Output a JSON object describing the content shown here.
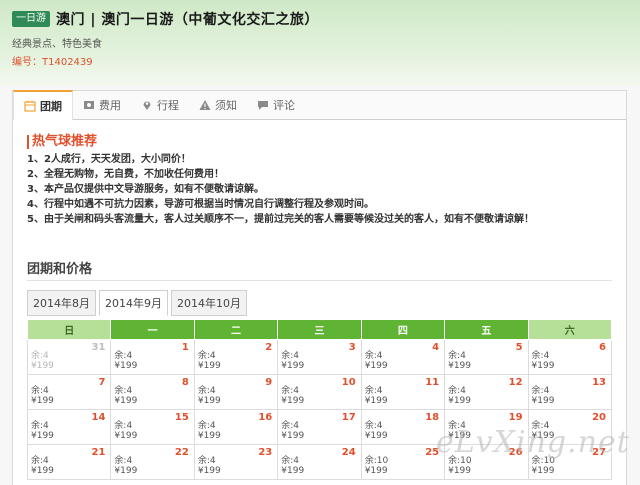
{
  "header": {
    "badge": "一日游",
    "title": "澳门 | 澳门一日游（中葡文化交汇之旅）",
    "subtitle": "经典景点、特色美食",
    "code": "编号：T1402439"
  },
  "tabs": [
    {
      "label": "团期",
      "icon": "calendar-icon",
      "active": true
    },
    {
      "label": "费用",
      "icon": "money-icon"
    },
    {
      "label": "行程",
      "icon": "map-pin-icon"
    },
    {
      "label": "须知",
      "icon": "warning-icon"
    },
    {
      "label": "评论",
      "icon": "comment-icon"
    }
  ],
  "promo": {
    "title": "热气球推荐",
    "items": [
      "1、2人成行，天天发团，大小同价！",
      "2、全程无购物，无自费，不加收任何费用！",
      "3、本产品仅提供中文导游服务，如有不便敬请谅解。",
      "4、行程中如遇不可抗力因素，导游可根据当时情况自行调整行程及参观时间。",
      "5、由于关闸和码头客流量大，客人过关顺序不一，提前过完关的客人需要等候没过关的客人，如有不便敬请谅解！"
    ]
  },
  "section_title": "团期和价格",
  "month_tabs": [
    "2014年8月",
    "2014年9月",
    "2014年10月"
  ],
  "active_month": 1,
  "weekdays": [
    "日",
    "一",
    "二",
    "三",
    "四",
    "五",
    "六"
  ],
  "calendar": [
    [
      {
        "d": "31",
        "s1": "余:4",
        "s2": "¥199",
        "past": true
      },
      {
        "d": "1",
        "s1": "余:4",
        "s2": "¥199"
      },
      {
        "d": "2",
        "s1": "余:4",
        "s2": "¥199"
      },
      {
        "d": "3",
        "s1": "余:4",
        "s2": "¥199"
      },
      {
        "d": "4",
        "s1": "余:4",
        "s2": "¥199"
      },
      {
        "d": "5",
        "s1": "余:4",
        "s2": "¥199"
      },
      {
        "d": "6",
        "s1": "余:4",
        "s2": "¥199"
      }
    ],
    [
      {
        "d": "7",
        "s1": "余:4",
        "s2": "¥199"
      },
      {
        "d": "8",
        "s1": "余:4",
        "s2": "¥199"
      },
      {
        "d": "9",
        "s1": "余:4",
        "s2": "¥199"
      },
      {
        "d": "10",
        "s1": "余:4",
        "s2": "¥199"
      },
      {
        "d": "11",
        "s1": "余:4",
        "s2": "¥199"
      },
      {
        "d": "12",
        "s1": "余:4",
        "s2": "¥199"
      },
      {
        "d": "13",
        "s1": "余:4",
        "s2": "¥199"
      }
    ],
    [
      {
        "d": "14",
        "s1": "余:4",
        "s2": "¥199"
      },
      {
        "d": "15",
        "s1": "余:4",
        "s2": "¥199"
      },
      {
        "d": "16",
        "s1": "余:4",
        "s2": "¥199"
      },
      {
        "d": "17",
        "s1": "余:4",
        "s2": "¥199"
      },
      {
        "d": "18",
        "s1": "余:4",
        "s2": "¥199"
      },
      {
        "d": "19",
        "s1": "余:4",
        "s2": "¥199"
      },
      {
        "d": "20",
        "s1": "余:4",
        "s2": "¥199"
      }
    ],
    [
      {
        "d": "21",
        "s1": "余:4",
        "s2": "¥199"
      },
      {
        "d": "22",
        "s1": "余:4",
        "s2": "¥199"
      },
      {
        "d": "23",
        "s1": "余:4",
        "s2": "¥199"
      },
      {
        "d": "24",
        "s1": "余:4",
        "s2": "¥199"
      },
      {
        "d": "25",
        "s1": "余:10",
        "s2": "¥199"
      },
      {
        "d": "26",
        "s1": "余:10",
        "s2": "¥199"
      },
      {
        "d": "27",
        "s1": "余:10",
        "s2": "¥199"
      }
    ]
  ],
  "watermark": "eLvXing.net",
  "colors": {
    "accent": "#e0502c",
    "header_green": "#5fb533",
    "weekend_green": "#b6df98",
    "badge_green": "#2e8b57",
    "tab_active_top": "#f2a232"
  }
}
